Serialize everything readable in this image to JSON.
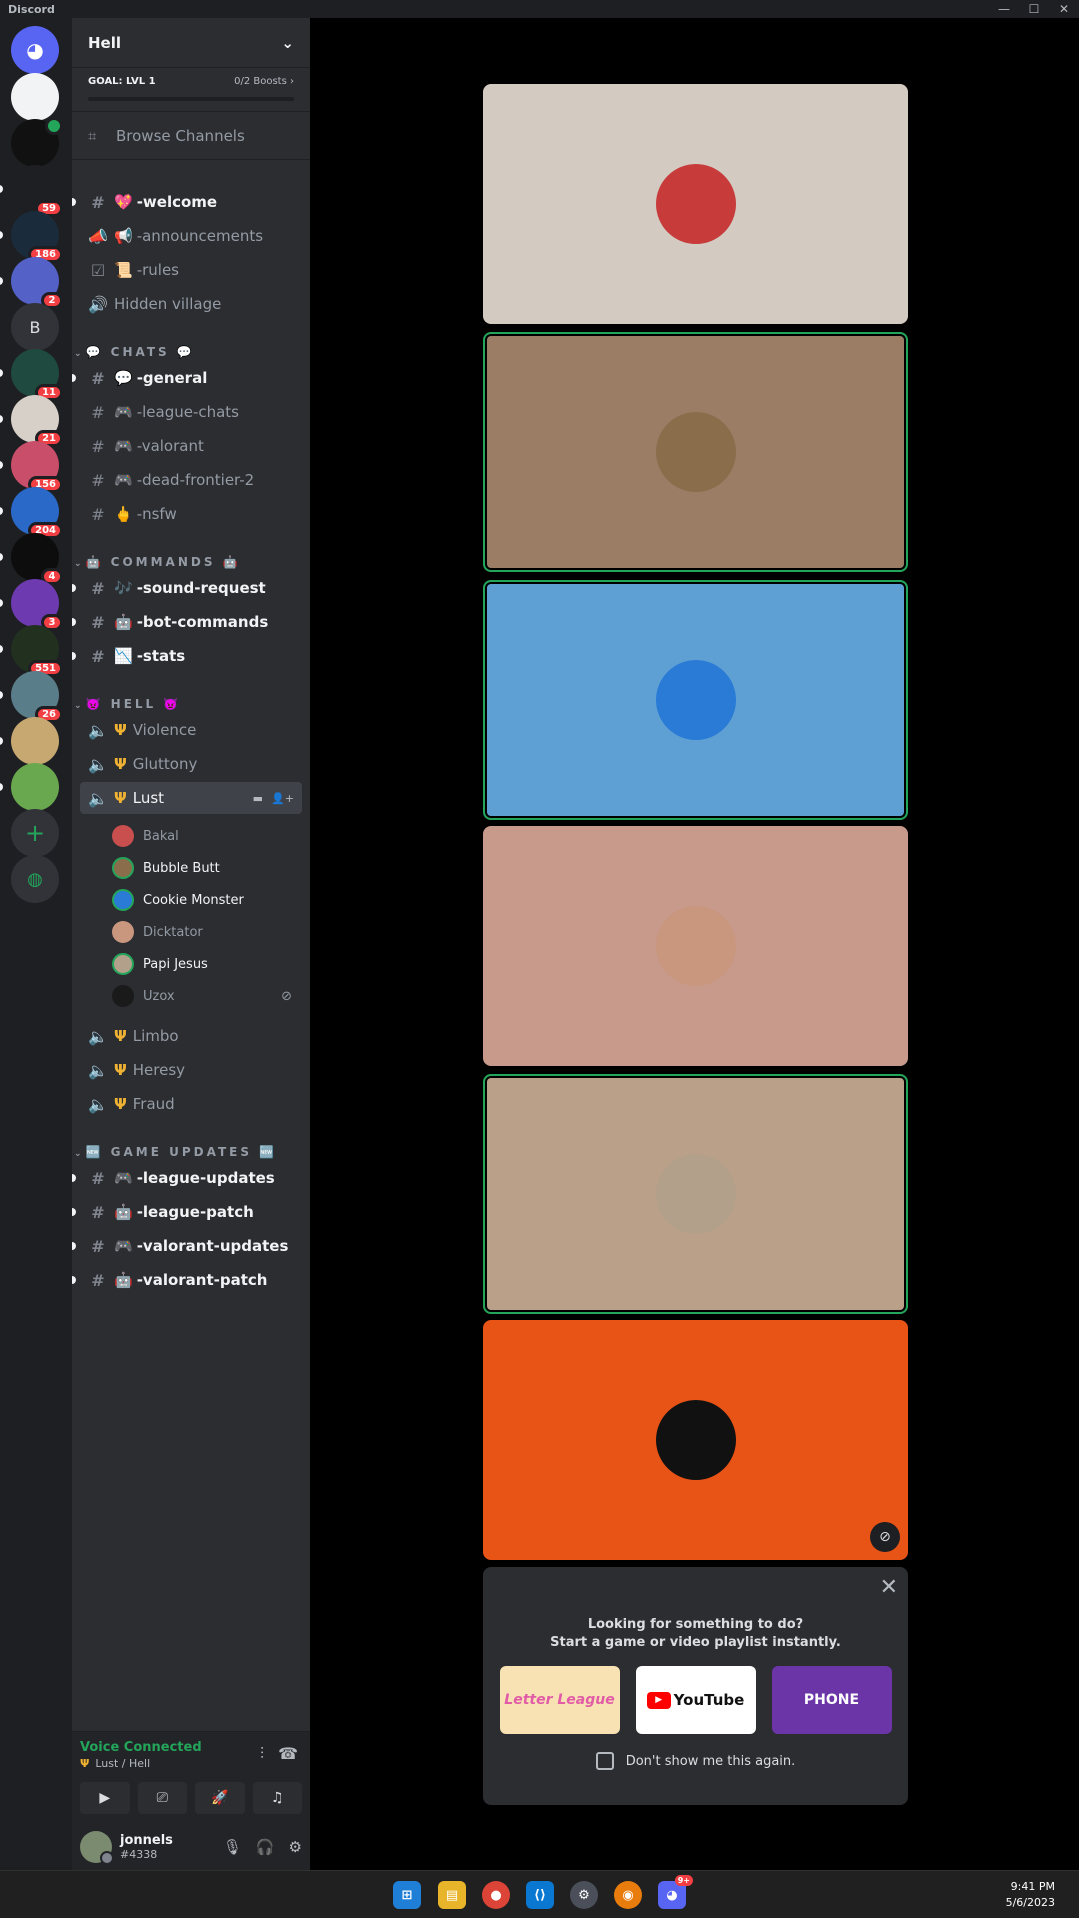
{
  "window": {
    "title": "Discord"
  },
  "servers": [
    {
      "name": "home",
      "color": "#5865f2"
    },
    {
      "name": "wings",
      "color": "#f2f3f5"
    },
    {
      "name": "hell",
      "color": "#111111"
    },
    {
      "name": "league",
      "color": "#1e1f22",
      "badge": "59"
    },
    {
      "name": "valorant",
      "color": "#1a2b3c",
      "badge": "186"
    },
    {
      "name": "pixel",
      "color": "#5462c8",
      "badge": "2"
    },
    {
      "name": "b",
      "color": "#313338",
      "letter": "B"
    },
    {
      "name": "green",
      "color": "#1f4a3f",
      "badge": "11"
    },
    {
      "name": "anime",
      "color": "#d7d0c8",
      "badge": "21"
    },
    {
      "name": "pink",
      "color": "#c94e6a",
      "badge": "156"
    },
    {
      "name": "blue",
      "color": "#2a69c8",
      "badge": "204"
    },
    {
      "name": "skull",
      "color": "#0d0d0d",
      "badge": "4"
    },
    {
      "name": "purple",
      "color": "#6d3ab0",
      "badge": "3"
    },
    {
      "name": "dark",
      "color": "#21301f",
      "badge": "551"
    },
    {
      "name": "teal",
      "color": "#5a7d8a",
      "badge": "26"
    },
    {
      "name": "jonels",
      "color": "#c8a871"
    },
    {
      "name": "pepe",
      "color": "#6aa84f"
    }
  ],
  "sidebar": {
    "server_name": "Hell",
    "boost_goal": "GOAL: LVL 1",
    "boost_count": "0/2 Boosts",
    "browse_label": "Browse Channels",
    "top_channels": [
      {
        "label": "-welcome",
        "emoji": "💖",
        "icon": "#",
        "unread": true
      },
      {
        "label": "-announcements",
        "emoji": "📢",
        "icon": "📣",
        "unread": false
      },
      {
        "label": "-rules",
        "emoji": "📜",
        "icon": "☑",
        "unread": false
      },
      {
        "label": "Hidden village",
        "emoji": "",
        "icon": "🔊",
        "unread": false
      }
    ],
    "cat_chats": "💬 CHATS 💬",
    "chat_channels": [
      {
        "label": "-general",
        "emoji": "💬",
        "unread": true
      },
      {
        "label": "-league-chats",
        "emoji": "🎮",
        "unread": false
      },
      {
        "label": "-valorant",
        "emoji": "🎮",
        "unread": false
      },
      {
        "label": "-dead-frontier-2",
        "emoji": "🎮",
        "unread": false
      },
      {
        "label": "-nsfw",
        "emoji": "🖕",
        "unread": false
      }
    ],
    "cat_commands": "🤖 COMMANDS 🤖",
    "command_channels": [
      {
        "label": "-sound-request",
        "emoji": "🎶",
        "unread": true
      },
      {
        "label": "-bot-commands",
        "emoji": "🤖",
        "unread": true
      },
      {
        "label": "-stats",
        "emoji": "📉",
        "unread": true
      }
    ],
    "cat_hell": "👿 HELL 👿",
    "hell_channels_top": [
      {
        "label": "Violence"
      },
      {
        "label": "Gluttony"
      },
      {
        "label": "Lust"
      }
    ],
    "voice_members": [
      {
        "name": "Bakal",
        "color": "#c94e4e",
        "speaking": false,
        "dim": true
      },
      {
        "name": "Bubble Butt",
        "color": "#8a6e4b",
        "speaking": true,
        "dim": false
      },
      {
        "name": "Cookie Monster",
        "color": "#2a7bd6",
        "speaking": true,
        "dim": false
      },
      {
        "name": "Dicktator",
        "color": "#c9967e",
        "speaking": false,
        "dim": true
      },
      {
        "name": "Papi Jesus",
        "color": "#b3a08a",
        "speaking": true,
        "dim": false
      },
      {
        "name": "Uzox",
        "color": "#1a1a1a",
        "speaking": false,
        "dim": true
      }
    ],
    "hell_channels_bottom": [
      {
        "label": "Limbo"
      },
      {
        "label": "Heresy"
      },
      {
        "label": "Fraud"
      }
    ],
    "cat_updates": "🆕 GAME UPDATES 🆕",
    "update_channels": [
      {
        "label": "-league-updates",
        "emoji": "🎮"
      },
      {
        "label": "-league-patch",
        "emoji": "🤖"
      },
      {
        "label": "-valorant-updates",
        "emoji": "🎮"
      },
      {
        "label": "-valorant-patch",
        "emoji": "🤖"
      }
    ]
  },
  "voice_panel": {
    "status": "Voice Connected",
    "location": "Lust / Hell"
  },
  "user": {
    "name": "jonnels",
    "tag": "#4338"
  },
  "stage": {
    "tiles": [
      {
        "bg": "#d3cbc1",
        "avatar": "#c73b3b",
        "speaking": false
      },
      {
        "bg": "#9b7d66",
        "avatar": "#8a6e4b",
        "speaking": true
      },
      {
        "bg": "#5e9fd4",
        "avatar": "#2a7bd6",
        "speaking": true
      },
      {
        "bg": "#c89a8b",
        "avatar": "#c9967e",
        "speaking": false
      },
      {
        "bg": "#bba089",
        "avatar": "#b3a08a",
        "speaking": true
      },
      {
        "bg": "#e85316",
        "avatar": "#111111",
        "speaking": false,
        "cam_off": true
      }
    ]
  },
  "activity": {
    "line1": "Looking for something to do?",
    "line2": "Start a game or video playlist instantly.",
    "card_letter": "Letter League",
    "card_youtube": "YouTube",
    "card_phone": "PHONE",
    "dont_show": "Don't show me this again."
  },
  "taskbar": {
    "time": "9:41 PM",
    "date": "5/6/2023",
    "discord_badge": "9+"
  }
}
